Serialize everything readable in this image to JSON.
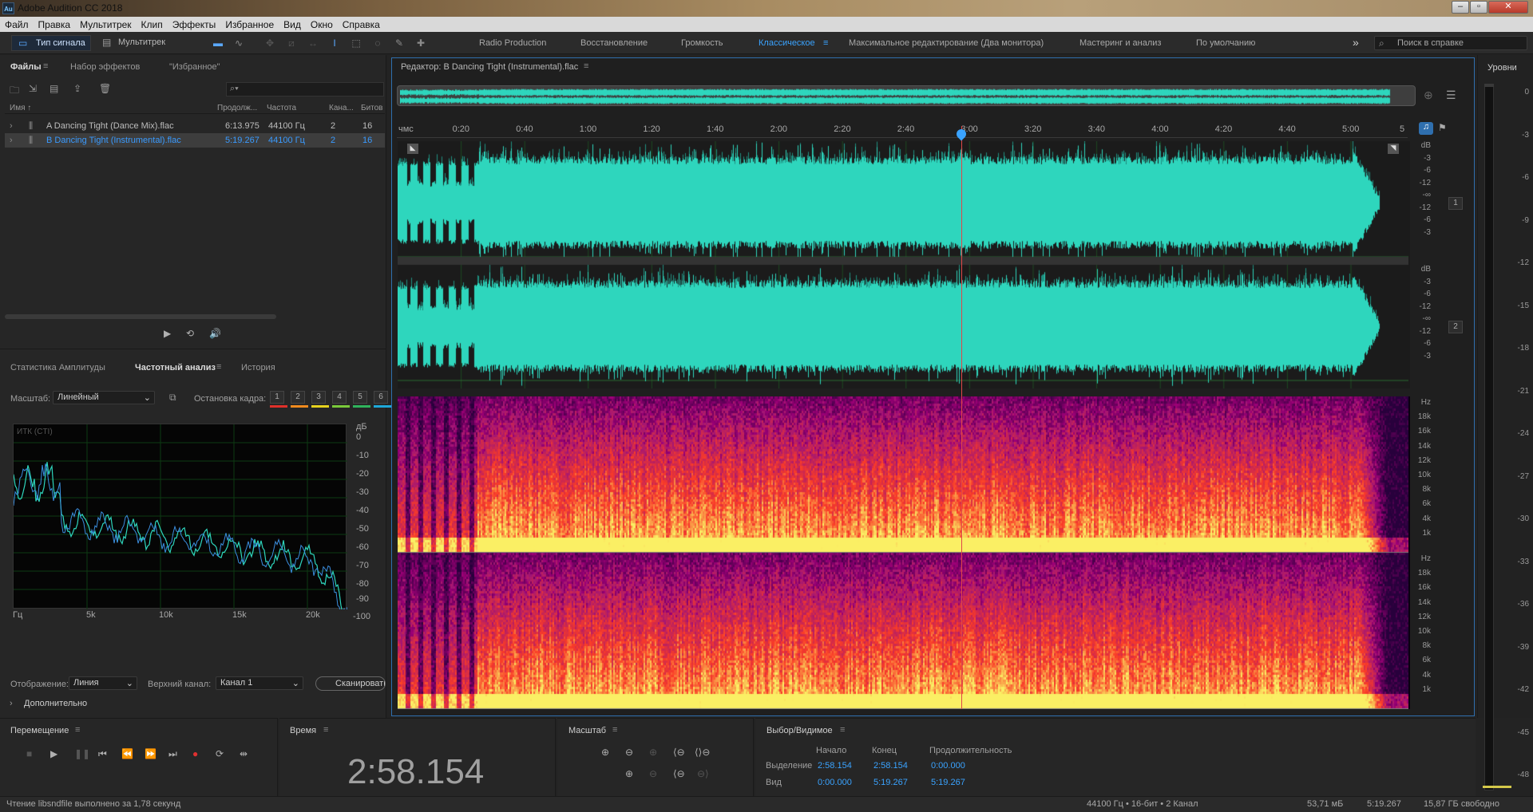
{
  "window": {
    "logo": "Au",
    "title": "Adobe Audition CC 2018",
    "buttons": [
      "–",
      "▫",
      "✕"
    ]
  },
  "menu": [
    "Файл",
    "Правка",
    "Мультитрек",
    "Клип",
    "Эффекты",
    "Избранное",
    "Вид",
    "Окно",
    "Справка"
  ],
  "toolbar": {
    "waveform_label": "Тип сигнала",
    "multitrack_label": "Мультитрек",
    "workspaces": [
      "Radio Production",
      "Восстановление",
      "Громкость",
      "Классическое",
      "Максимальное редактирование (Два монитора)",
      "Мастеринг и анализ",
      "По умолчанию"
    ],
    "active_workspace": "Классическое",
    "help_search_placeholder": "Поиск в справке",
    "more_label": "»"
  },
  "files_panel": {
    "tabs": [
      "Файлы",
      "Набор эффектов",
      "\"Избранное\""
    ],
    "columns": [
      "Имя ↑",
      "Продолж...",
      "Частота",
      "Кана...",
      "Битов"
    ],
    "files": [
      {
        "name": "A Dancing Tight (Dance Mix).flac",
        "duration": "6:13.975",
        "rate": "44100 Гц",
        "channels": "2",
        "bits": "16",
        "selected": false
      },
      {
        "name": "B Dancing Tight (Instrumental).flac",
        "duration": "5:19.267",
        "rate": "44100 Гц",
        "channels": "2",
        "bits": "16",
        "selected": true
      }
    ],
    "search_icon": "search-icon"
  },
  "analysis_panel": {
    "tabs": [
      "Статистика Амплитуды",
      "Частотный анализ",
      "История"
    ],
    "scale_label": "Масштаб:",
    "scale_value": "Линейный",
    "freeze_label": "Остановка кадра:",
    "freeze_buttons": [
      "1",
      "2",
      "3",
      "4",
      "5",
      "6"
    ],
    "freeze_colors": [
      "#e0302a",
      "#f08a1e",
      "#e6d21e",
      "#7ac93a",
      "#2fb35c",
      "#1ea8d8"
    ],
    "plot_label": "ИТК (CTI)",
    "db_axis": [
      "дБ",
      "0",
      "-10",
      "-20",
      "-30",
      "-40",
      "-50",
      "-60",
      "-70",
      "-80",
      "-90",
      "-100"
    ],
    "hz_axis": [
      "Гц",
      "5k",
      "10k",
      "15k",
      "20k"
    ],
    "display_label": "Отображение:",
    "display_value": "Линия",
    "channel_label": "Верхний канал:",
    "channel_value": "Канал 1",
    "scan_label": "Сканировать",
    "advanced_label": "Дополнительно"
  },
  "editor": {
    "title": "Редактор: B Dancing Tight (Instrumental).flac",
    "time_ruler": [
      "чмс",
      "0:20",
      "0:40",
      "1:00",
      "1:20",
      "1:40",
      "2:00",
      "2:20",
      "2:40",
      "3:00",
      "3:20",
      "3:40",
      "4:00",
      "4:20",
      "4:40",
      "5:00",
      "5"
    ],
    "db_ruler": [
      "dB",
      "-3",
      "-6",
      "-12",
      "-∞",
      "-12",
      "-6",
      "-3"
    ],
    "hz_ruler": [
      "Hz",
      "18k",
      "16k",
      "14k",
      "12k",
      "10k",
      "8k",
      "6k",
      "4k",
      "1k"
    ],
    "channel1": "1",
    "channel2": "2",
    "playhead_fraction": 0.5578,
    "waveform_color": "#2ed6bd"
  },
  "levels": {
    "title": "Уровни",
    "scale": [
      "0",
      "-3",
      "-6",
      "-9",
      "-12",
      "-15",
      "-18",
      "-21",
      "-24",
      "-27",
      "-30",
      "-33",
      "-36",
      "-39",
      "-42",
      "-45",
      "-48"
    ]
  },
  "transport": {
    "title": "Перемещение",
    "buttons": [
      "stop-icon",
      "play-icon",
      "pause-icon",
      "to-start-icon",
      "rewind-icon",
      "fast-forward-icon",
      "to-end-icon",
      "record-icon",
      "loop-icon",
      "skip-selection-icon"
    ]
  },
  "time_panel": {
    "title": "Время",
    "value": "2:58.154"
  },
  "zoom_panel": {
    "title": "Масштаб"
  },
  "selection_panel": {
    "title": "Выбор/Видимое",
    "headers": [
      "Начало",
      "Конец",
      "Продолжительность"
    ],
    "rows": [
      {
        "label": "Выделение",
        "start": "2:58.154",
        "end": "2:58.154",
        "duration": "0:00.000"
      },
      {
        "label": "Вид",
        "start": "0:00.000",
        "end": "5:19.267",
        "duration": "5:19.267"
      }
    ]
  },
  "status": {
    "left": "Чтение libsndfile выполнено за 1,78 секунд",
    "format": "44100 Гц • 16-бит • 2 Канал",
    "size": "53,71 мБ",
    "duration": "5:19.267",
    "free": "15,87 ГБ свободно"
  }
}
